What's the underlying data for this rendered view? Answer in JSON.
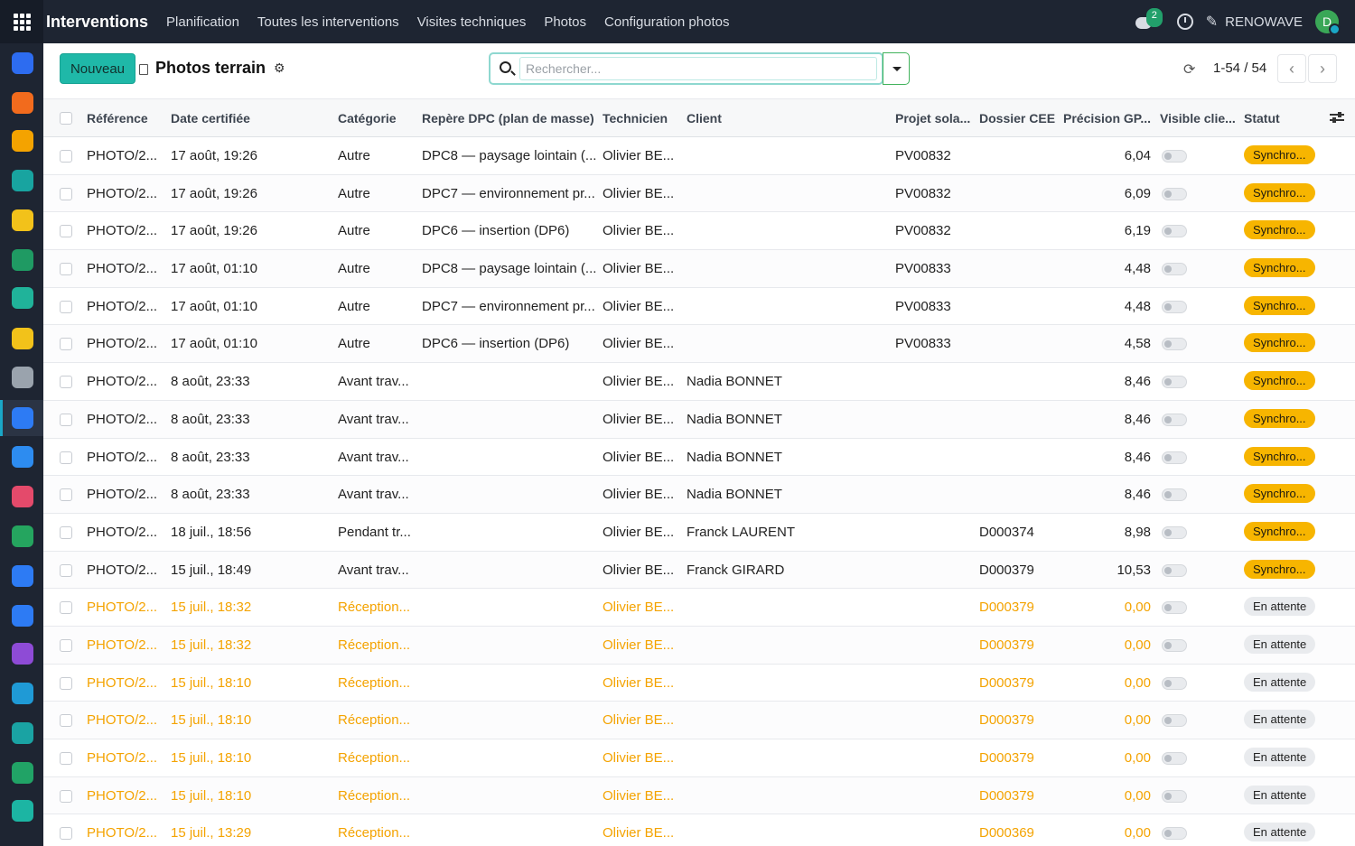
{
  "navbar": {
    "brand": "Interventions",
    "menu": [
      "Planification",
      "Toutes les interventions",
      "Visites techniques",
      "Photos",
      "Configuration photos"
    ],
    "chat_badge": "2",
    "company": "RENOWAVE",
    "avatar_initial": "D"
  },
  "sidebar": {
    "icons": [
      {
        "name": "app-icon-1",
        "color": "#2d6cf0"
      },
      {
        "name": "app-icon-2",
        "color": "#f26b1d"
      },
      {
        "name": "calendar-31-icon",
        "color": "#f4a300"
      },
      {
        "name": "sign-icon",
        "color": "#18a4a0"
      },
      {
        "name": "disc-icon",
        "color": "#f2c21a"
      },
      {
        "name": "contact-icon",
        "color": "#1f9a63"
      },
      {
        "name": "rocket-icon",
        "color": "#20b39a"
      },
      {
        "name": "disc-icon-2",
        "color": "#f2c21a"
      },
      {
        "name": "bank-icon",
        "color": "#9aa3ad"
      },
      {
        "name": "active-app-icon",
        "color": "#2d7bf4"
      },
      {
        "name": "planner-icon",
        "color": "#2d8cf0"
      },
      {
        "name": "dashboard-icon",
        "color": "#e44a6b"
      },
      {
        "name": "app-icon-13",
        "color": "#25a55f"
      },
      {
        "name": "calendar-icon",
        "color": "#2d7bf4"
      },
      {
        "name": "app-icon-15",
        "color": "#2d7bf4"
      },
      {
        "name": "app-icon-16",
        "color": "#8e4bd6"
      },
      {
        "name": "app-icon-17",
        "color": "#1f9ad6"
      },
      {
        "name": "team-icon",
        "color": "#1aa3a3"
      },
      {
        "name": "spreadsheet-icon",
        "color": "#21a366"
      },
      {
        "name": "pencil-icon",
        "color": "#1cb5a3"
      }
    ]
  },
  "control": {
    "new_label": "Nouveau",
    "title": "Photos terrain",
    "search_placeholder": "Rechercher...",
    "pager": "1-54 / 54"
  },
  "table": {
    "headers": [
      "Référence",
      "Date certifiée",
      "Catégorie",
      "Repère DPC (plan de masse)",
      "Technicien",
      "Client",
      "Projet sola...",
      "Dossier CEE",
      "Précision GP...",
      "Visible clie...",
      "Statut"
    ],
    "rows": [
      {
        "ref": "PHOTO/2...",
        "date": "17 août, 19:26",
        "cat": "Autre",
        "dpc": "DPC8 — paysage lointain (...",
        "tech": "Olivier BE...",
        "client": "",
        "projet": "PV00832",
        "cee": "",
        "gps": "6,04",
        "status": "Synchro...",
        "state": "sync"
      },
      {
        "ref": "PHOTO/2...",
        "date": "17 août, 19:26",
        "cat": "Autre",
        "dpc": "DPC7 — environnement pr...",
        "tech": "Olivier BE...",
        "client": "",
        "projet": "PV00832",
        "cee": "",
        "gps": "6,09",
        "status": "Synchro...",
        "state": "sync"
      },
      {
        "ref": "PHOTO/2...",
        "date": "17 août, 19:26",
        "cat": "Autre",
        "dpc": "DPC6 — insertion (DP6)",
        "tech": "Olivier BE...",
        "client": "",
        "projet": "PV00832",
        "cee": "",
        "gps": "6,19",
        "status": "Synchro...",
        "state": "sync"
      },
      {
        "ref": "PHOTO/2...",
        "date": "17 août, 01:10",
        "cat": "Autre",
        "dpc": "DPC8 — paysage lointain (...",
        "tech": "Olivier BE...",
        "client": "",
        "projet": "PV00833",
        "cee": "",
        "gps": "4,48",
        "status": "Synchro...",
        "state": "sync"
      },
      {
        "ref": "PHOTO/2...",
        "date": "17 août, 01:10",
        "cat": "Autre",
        "dpc": "DPC7 — environnement pr...",
        "tech": "Olivier BE...",
        "client": "",
        "projet": "PV00833",
        "cee": "",
        "gps": "4,48",
        "status": "Synchro...",
        "state": "sync"
      },
      {
        "ref": "PHOTO/2...",
        "date": "17 août, 01:10",
        "cat": "Autre",
        "dpc": "DPC6 — insertion (DP6)",
        "tech": "Olivier BE...",
        "client": "",
        "projet": "PV00833",
        "cee": "",
        "gps": "4,58",
        "status": "Synchro...",
        "state": "sync"
      },
      {
        "ref": "PHOTO/2...",
        "date": "8 août, 23:33",
        "cat": "Avant trav...",
        "dpc": "",
        "tech": "Olivier BE...",
        "client": "Nadia BONNET",
        "projet": "",
        "cee": "",
        "gps": "8,46",
        "status": "Synchro...",
        "state": "sync"
      },
      {
        "ref": "PHOTO/2...",
        "date": "8 août, 23:33",
        "cat": "Avant trav...",
        "dpc": "",
        "tech": "Olivier BE...",
        "client": "Nadia BONNET",
        "projet": "",
        "cee": "",
        "gps": "8,46",
        "status": "Synchro...",
        "state": "sync"
      },
      {
        "ref": "PHOTO/2...",
        "date": "8 août, 23:33",
        "cat": "Avant trav...",
        "dpc": "",
        "tech": "Olivier BE...",
        "client": "Nadia BONNET",
        "projet": "",
        "cee": "",
        "gps": "8,46",
        "status": "Synchro...",
        "state": "sync"
      },
      {
        "ref": "PHOTO/2...",
        "date": "8 août, 23:33",
        "cat": "Avant trav...",
        "dpc": "",
        "tech": "Olivier BE...",
        "client": "Nadia BONNET",
        "projet": "",
        "cee": "",
        "gps": "8,46",
        "status": "Synchro...",
        "state": "sync"
      },
      {
        "ref": "PHOTO/2...",
        "date": "18 juil., 18:56",
        "cat": "Pendant tr...",
        "dpc": "",
        "tech": "Olivier BE...",
        "client": "Franck LAURENT",
        "projet": "",
        "cee": "D000374",
        "gps": "8,98",
        "status": "Synchro...",
        "state": "sync"
      },
      {
        "ref": "PHOTO/2...",
        "date": "15 juil., 18:49",
        "cat": "Avant trav...",
        "dpc": "",
        "tech": "Olivier BE...",
        "client": "Franck GIRARD",
        "projet": "",
        "cee": "D000379",
        "gps": "10,53",
        "status": "Synchro...",
        "state": "sync"
      },
      {
        "ref": "PHOTO/2...",
        "date": "15 juil., 18:32",
        "cat": "Réception...",
        "dpc": "",
        "tech": "Olivier BE...",
        "client": "",
        "projet": "",
        "cee": "D000379",
        "gps": "0,00",
        "status": "En attente",
        "state": "wait"
      },
      {
        "ref": "PHOTO/2...",
        "date": "15 juil., 18:32",
        "cat": "Réception...",
        "dpc": "",
        "tech": "Olivier BE...",
        "client": "",
        "projet": "",
        "cee": "D000379",
        "gps": "0,00",
        "status": "En attente",
        "state": "wait"
      },
      {
        "ref": "PHOTO/2...",
        "date": "15 juil., 18:10",
        "cat": "Réception...",
        "dpc": "",
        "tech": "Olivier BE...",
        "client": "",
        "projet": "",
        "cee": "D000379",
        "gps": "0,00",
        "status": "En attente",
        "state": "wait"
      },
      {
        "ref": "PHOTO/2...",
        "date": "15 juil., 18:10",
        "cat": "Réception...",
        "dpc": "",
        "tech": "Olivier BE...",
        "client": "",
        "projet": "",
        "cee": "D000379",
        "gps": "0,00",
        "status": "En attente",
        "state": "wait"
      },
      {
        "ref": "PHOTO/2...",
        "date": "15 juil., 18:10",
        "cat": "Réception...",
        "dpc": "",
        "tech": "Olivier BE...",
        "client": "",
        "projet": "",
        "cee": "D000379",
        "gps": "0,00",
        "status": "En attente",
        "state": "wait"
      },
      {
        "ref": "PHOTO/2...",
        "date": "15 juil., 18:10",
        "cat": "Réception...",
        "dpc": "",
        "tech": "Olivier BE...",
        "client": "",
        "projet": "",
        "cee": "D000379",
        "gps": "0,00",
        "status": "En attente",
        "state": "wait"
      },
      {
        "ref": "PHOTO/2...",
        "date": "15 juil., 13:29",
        "cat": "Réception...",
        "dpc": "",
        "tech": "Olivier BE...",
        "client": "",
        "projet": "",
        "cee": "D000369",
        "gps": "0,00",
        "status": "En attente",
        "state": "wait"
      }
    ]
  },
  "colors": {
    "navbar": "#1e2532",
    "primary": "#1fb8a8",
    "sync_badge": "#f7b500",
    "pending_text": "#f4a300"
  }
}
